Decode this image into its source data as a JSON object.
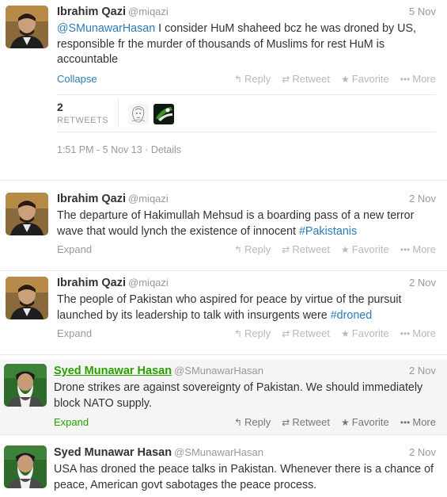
{
  "tweets": [
    {
      "fullname": "Ibrahim Qazi",
      "handle": "@miqazi",
      "date": "5 Nov",
      "mention": "@SMunawarHasan",
      "text": " I consider HuM shaheed bcz he was droned by US, responsible fr the murder of thousands of Muslims for rest HuM is accountable",
      "toggle": "Collapse",
      "actions": {
        "reply": "Reply",
        "retweet": "Retweet",
        "favorite": "Favorite",
        "more": "More"
      },
      "retweets_count": "2",
      "retweets_label": "RETWEETS",
      "time": "1:51 PM - 5 Nov 13",
      "details": "Details"
    },
    {
      "fullname": "Ibrahim Qazi",
      "handle": "@miqazi",
      "date": "2 Nov",
      "text": "The departure of Hakimullah Mehsud is a boarding pass of a new terror wave that would lynch the existence of innocent ",
      "hashtag": "#Pakistanis",
      "toggle": "Expand",
      "actions": {
        "reply": "Reply",
        "retweet": "Retweet",
        "favorite": "Favorite",
        "more": "More"
      }
    },
    {
      "fullname": "Ibrahim Qazi",
      "handle": "@miqazi",
      "date": "2 Nov",
      "text": "The people of Pakistan who aspired for peace by virtue of the pursuit launched by its leadership to talk with insurgents were ",
      "hashtag": "#droned",
      "toggle": "Expand",
      "actions": {
        "reply": "Reply",
        "retweet": "Retweet",
        "favorite": "Favorite",
        "more": "More"
      }
    },
    {
      "fullname": "Syed Munawar Hasan",
      "handle": "@SMunawarHasan",
      "date": "2 Nov",
      "text": "Drone strikes are against sovereignty of Pakistan. We should immediately block NATO supply.",
      "toggle": "Expand",
      "actions": {
        "reply": "Reply",
        "retweet": "Retweet",
        "favorite": "Favorite",
        "more": "More"
      }
    },
    {
      "fullname": "Syed Munawar Hasan",
      "handle": "@SMunawarHasan",
      "date": "2 Nov",
      "text": "USA has droned the peace talks in Pakistan. Whenever there is a chance of peace, American govt sabotages the peace process."
    }
  ],
  "icons": {
    "reply": "reply-icon",
    "retweet": "retweet-icon",
    "favorite": "star-icon",
    "more": "more-icon"
  },
  "colors": {
    "link": "#2b7bb9",
    "highlight_name": "#2aa000",
    "muted": "#999999"
  }
}
